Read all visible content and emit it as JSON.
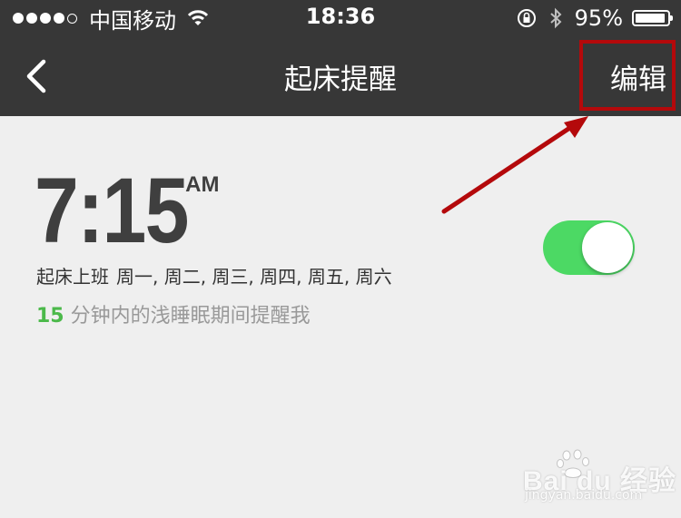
{
  "status_bar": {
    "carrier": "中国移动",
    "time": "18:36",
    "battery_percent": "95%",
    "battery_level": 0.95,
    "signal_bars_filled": 4,
    "signal_bars_total": 5,
    "icons": [
      "wifi-icon",
      "rotation-lock-icon",
      "bluetooth-icon",
      "battery-icon"
    ]
  },
  "nav": {
    "back_icon": "chevron-left-icon",
    "title": "起床提醒",
    "edit_label": "编辑"
  },
  "alarm": {
    "time": "7:15",
    "ampm": "AM",
    "label": "起床上班",
    "repeat": "周一, 周二, 周三, 周四, 周五, 周六",
    "enabled": true,
    "smart_minutes": "15",
    "smart_text": " 分钟内的浅睡眠期间提醒我"
  },
  "annotation": {
    "box_color": "#b4090b",
    "arrow_color": "#b4090b"
  },
  "colors": {
    "nav_bg": "#373737",
    "page_bg": "#efefef",
    "toggle_on": "#4cd964",
    "accent_green": "#4bb94a"
  },
  "watermark": {
    "logo": "Bai du 经验",
    "url": "jingyan.baidu.com"
  }
}
